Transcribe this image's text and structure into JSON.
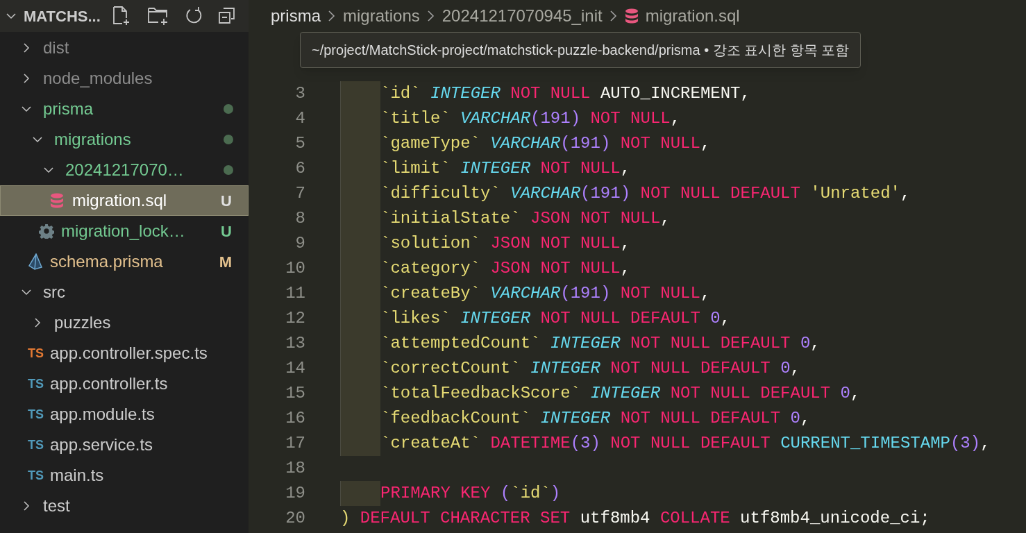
{
  "explorer": {
    "title": "MATCHS...",
    "expanded": true,
    "tree": [
      {
        "name": "dist",
        "kind": "folder",
        "expanded": false,
        "selected": false,
        "color": "#8c8c8c"
      },
      {
        "name": "node_modules",
        "kind": "folder",
        "expanded": false,
        "selected": false,
        "color": "#8c8c8c"
      },
      {
        "name": "prisma",
        "kind": "folder",
        "expanded": true,
        "selected": false,
        "color": "#73c991",
        "dot": true,
        "children": [
          {
            "name": "migrations",
            "kind": "folder",
            "expanded": true,
            "selected": false,
            "color": "#73c991",
            "dot": true,
            "children": [
              {
                "name": "20241217070…",
                "kind": "folder",
                "expanded": true,
                "selected": false,
                "color": "#73c991",
                "dot": true,
                "children": [
                  {
                    "name": "migration.sql",
                    "kind": "sql-file",
                    "selected": true,
                    "badge": "U"
                  }
                ]
              },
              {
                "name": "migration_lock…",
                "kind": "config-file",
                "selected": false,
                "color": "#73c991",
                "badge": "U"
              }
            ]
          },
          {
            "name": "schema.prisma",
            "kind": "prisma-file",
            "selected": false,
            "color": "#e2c08d",
            "badge": "M"
          }
        ]
      },
      {
        "name": "src",
        "kind": "folder",
        "expanded": true,
        "selected": false,
        "color": "#cccccc",
        "children": [
          {
            "name": "puzzles",
            "kind": "folder",
            "expanded": false,
            "selected": false,
            "color": "#cccccc"
          },
          {
            "name": "app.controller.spec.ts",
            "kind": "ts-test-file",
            "icon_text": "TS",
            "selected": false,
            "color": "#cccccc"
          },
          {
            "name": "app.controller.ts",
            "kind": "ts-file",
            "icon_text": "TS",
            "selected": false,
            "color": "#cccccc"
          },
          {
            "name": "app.module.ts",
            "kind": "ts-file",
            "icon_text": "TS",
            "selected": false,
            "color": "#cccccc"
          },
          {
            "name": "app.service.ts",
            "kind": "ts-file",
            "icon_text": "TS",
            "selected": false,
            "color": "#cccccc"
          },
          {
            "name": "main.ts",
            "kind": "ts-file",
            "icon_text": "TS",
            "selected": false,
            "color": "#cccccc"
          }
        ]
      },
      {
        "name": "test",
        "kind": "folder",
        "expanded": false,
        "selected": false,
        "color": "#cccccc"
      }
    ]
  },
  "breadcrumbs": [
    {
      "label": "prisma",
      "kind": "folder"
    },
    {
      "label": "migrations",
      "kind": "folder"
    },
    {
      "label": "20241217070945_init",
      "kind": "folder"
    },
    {
      "label": "migration.sql",
      "kind": "sql-file"
    }
  ],
  "tooltip": "~/project/MatchStick-project/matchstick-puzzle-backend/prisma • 강조 표시한 항목 포함",
  "editor": {
    "lines": [
      {
        "number": "3",
        "indented": true,
        "tokens": [
          {
            "kind": "ident",
            "text": "`id` "
          },
          {
            "kind": "type",
            "text": "INTEGER"
          },
          {
            "kind": "keyword",
            "text": " NOT NULL "
          },
          {
            "kind": "plain",
            "text": "AUTO_INCREMENT,"
          }
        ]
      },
      {
        "number": "4",
        "indented": true,
        "tokens": [
          {
            "kind": "ident",
            "text": "`title` "
          },
          {
            "kind": "type",
            "text": "VARCHAR"
          },
          {
            "kind": "number",
            "text": "(191)"
          },
          {
            "kind": "keyword",
            "text": " NOT NULL"
          },
          {
            "kind": "plain",
            "text": ","
          }
        ]
      },
      {
        "number": "5",
        "indented": true,
        "tokens": [
          {
            "kind": "ident",
            "text": "`gameType` "
          },
          {
            "kind": "type",
            "text": "VARCHAR"
          },
          {
            "kind": "number",
            "text": "(191)"
          },
          {
            "kind": "keyword",
            "text": " NOT NULL"
          },
          {
            "kind": "plain",
            "text": ","
          }
        ]
      },
      {
        "number": "6",
        "indented": true,
        "tokens": [
          {
            "kind": "ident",
            "text": "`limit` "
          },
          {
            "kind": "type",
            "text": "INTEGER"
          },
          {
            "kind": "keyword",
            "text": " NOT NULL"
          },
          {
            "kind": "plain",
            "text": ","
          }
        ]
      },
      {
        "number": "7",
        "indented": true,
        "tokens": [
          {
            "kind": "ident",
            "text": "`difficulty` "
          },
          {
            "kind": "type",
            "text": "VARCHAR"
          },
          {
            "kind": "number",
            "text": "(191)"
          },
          {
            "kind": "keyword",
            "text": " NOT NULL DEFAULT "
          },
          {
            "kind": "string",
            "text": "'Unrated'"
          },
          {
            "kind": "plain",
            "text": ","
          }
        ]
      },
      {
        "number": "8",
        "indented": true,
        "tokens": [
          {
            "kind": "ident",
            "text": "`initialState` "
          },
          {
            "kind": "keyword",
            "text": "JSON NOT NULL"
          },
          {
            "kind": "plain",
            "text": ","
          }
        ]
      },
      {
        "number": "9",
        "indented": true,
        "tokens": [
          {
            "kind": "ident",
            "text": "`solution` "
          },
          {
            "kind": "keyword",
            "text": "JSON NOT NULL"
          },
          {
            "kind": "plain",
            "text": ","
          }
        ]
      },
      {
        "number": "10",
        "indented": true,
        "tokens": [
          {
            "kind": "ident",
            "text": "`category` "
          },
          {
            "kind": "keyword",
            "text": "JSON NOT NULL"
          },
          {
            "kind": "plain",
            "text": ","
          }
        ]
      },
      {
        "number": "11",
        "indented": true,
        "tokens": [
          {
            "kind": "ident",
            "text": "`createBy` "
          },
          {
            "kind": "type",
            "text": "VARCHAR"
          },
          {
            "kind": "number",
            "text": "(191)"
          },
          {
            "kind": "keyword",
            "text": " NOT NULL"
          },
          {
            "kind": "plain",
            "text": ","
          }
        ]
      },
      {
        "number": "12",
        "indented": true,
        "tokens": [
          {
            "kind": "ident",
            "text": "`likes` "
          },
          {
            "kind": "type",
            "text": "INTEGER"
          },
          {
            "kind": "keyword",
            "text": " NOT NULL DEFAULT "
          },
          {
            "kind": "number",
            "text": "0"
          },
          {
            "kind": "plain",
            "text": ","
          }
        ]
      },
      {
        "number": "13",
        "indented": true,
        "tokens": [
          {
            "kind": "ident",
            "text": "`attemptedCount` "
          },
          {
            "kind": "type",
            "text": "INTEGER"
          },
          {
            "kind": "keyword",
            "text": " NOT NULL DEFAULT "
          },
          {
            "kind": "number",
            "text": "0"
          },
          {
            "kind": "plain",
            "text": ","
          }
        ]
      },
      {
        "number": "14",
        "indented": true,
        "tokens": [
          {
            "kind": "ident",
            "text": "`correctCount` "
          },
          {
            "kind": "type",
            "text": "INTEGER"
          },
          {
            "kind": "keyword",
            "text": " NOT NULL DEFAULT "
          },
          {
            "kind": "number",
            "text": "0"
          },
          {
            "kind": "plain",
            "text": ","
          }
        ]
      },
      {
        "number": "15",
        "indented": true,
        "tokens": [
          {
            "kind": "ident",
            "text": "`totalFeedbackScore` "
          },
          {
            "kind": "type",
            "text": "INTEGER"
          },
          {
            "kind": "keyword",
            "text": " NOT NULL DEFAULT "
          },
          {
            "kind": "number",
            "text": "0"
          },
          {
            "kind": "plain",
            "text": ","
          }
        ]
      },
      {
        "number": "16",
        "indented": true,
        "tokens": [
          {
            "kind": "ident",
            "text": "`feedbackCount` "
          },
          {
            "kind": "type",
            "text": "INTEGER"
          },
          {
            "kind": "keyword",
            "text": " NOT NULL DEFAULT "
          },
          {
            "kind": "number",
            "text": "0"
          },
          {
            "kind": "plain",
            "text": ","
          }
        ]
      },
      {
        "number": "17",
        "indented": true,
        "tokens": [
          {
            "kind": "ident",
            "text": "`createAt` "
          },
          {
            "kind": "keyword",
            "text": "DATETIME"
          },
          {
            "kind": "number",
            "text": "(3)"
          },
          {
            "kind": "keyword",
            "text": " NOT NULL DEFAULT "
          },
          {
            "kind": "func",
            "text": "CURRENT_TIMESTAMP"
          },
          {
            "kind": "number",
            "text": "(3)"
          },
          {
            "kind": "plain",
            "text": ","
          }
        ]
      },
      {
        "number": "18",
        "indented": false
      },
      {
        "number": "19",
        "indented": true,
        "tokens": [
          {
            "kind": "keyword",
            "text": "PRIMARY KEY "
          },
          {
            "kind": "number",
            "text": "("
          },
          {
            "kind": "ident",
            "text": "`id`"
          },
          {
            "kind": "number",
            "text": ")"
          }
        ]
      },
      {
        "number": "20",
        "indented": false,
        "tokens": [
          {
            "kind": "paren",
            "text": ") "
          },
          {
            "kind": "keyword",
            "text": "DEFAULT CHARACTER SET "
          },
          {
            "kind": "plain",
            "text": "utf8mb4 "
          },
          {
            "kind": "keyword",
            "text": "COLLATE "
          },
          {
            "kind": "plain",
            "text": "utf8mb4_unicode_ci;"
          }
        ]
      }
    ]
  }
}
